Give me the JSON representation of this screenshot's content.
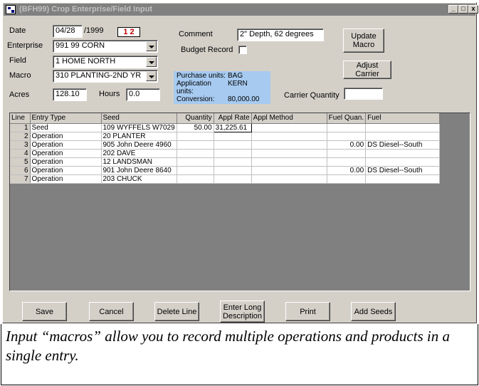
{
  "window": {
    "title": "(BFH99)  Crop Enterprise/Field Input",
    "min": "_",
    "max": "□",
    "close": "x"
  },
  "form": {
    "date_label": "Date",
    "date_value": "04/28",
    "year_value": "/1999",
    "calendar_text": "1 2",
    "enterprise_label": "Enterprise",
    "enterprise_value": "991  99 CORN",
    "field_label": "Field",
    "field_value": "1  HOME NORTH",
    "macro_label": "Macro",
    "macro_value": "310  PLANTING-2ND YR",
    "acres_label": "Acres",
    "acres_value": "128.10",
    "hours_label": "Hours",
    "hours_value": "0.0",
    "comment_label": "Comment",
    "comment_value": "2\" Depth, 62 degrees",
    "budget_label": "Budget Record",
    "carrier_label": "Carrier Quantity",
    "carrier_value": ""
  },
  "units": {
    "purchase_label": "Purchase units:",
    "purchase_value": "BAG",
    "application_label": "Application units:",
    "application_value": "KERN",
    "conversion_label": "Conversion:",
    "conversion_value": "80,000.00"
  },
  "side_buttons": {
    "update_macro": "Update Macro",
    "adjust_carrier": "Adjust Carrier"
  },
  "grid": {
    "headers": [
      "Line",
      "Entry Type",
      "Seed",
      "Quantity",
      "Appl Rate",
      "Appl Method",
      "Fuel Quan.",
      "Fuel"
    ],
    "rows": [
      [
        "1",
        "Seed",
        "109  WYFFELS W7029",
        "50.00",
        "31,225.61",
        "",
        "",
        ""
      ],
      [
        "2",
        "Operation",
        "20  PLANTER",
        "",
        "",
        "",
        "",
        ""
      ],
      [
        "3",
        "Operation",
        "905  John Deere 4960",
        "",
        "",
        "",
        "0.00",
        "DS  Diesel--South"
      ],
      [
        "4",
        "Operation",
        "202  DAVE",
        "",
        "",
        "",
        "",
        ""
      ],
      [
        "5",
        "Operation",
        "12  LANDSMAN",
        "",
        "",
        "",
        "",
        ""
      ],
      [
        "6",
        "Operation",
        "901  John Deere 8640",
        "",
        "",
        "",
        "0.00",
        "DS  Diesel--South"
      ],
      [
        "7",
        "Operation",
        "203  CHUCK",
        "",
        "",
        "",
        "",
        ""
      ]
    ]
  },
  "bottom_buttons": {
    "save": "Save",
    "cancel": "Cancel",
    "delete_line": "Delete Line",
    "enter_long_description": "Enter Long Description",
    "print": "Print",
    "add_seeds": "Add Seeds"
  },
  "caption": "Input “macros” allow you to record multiple operations and products in a single entry."
}
